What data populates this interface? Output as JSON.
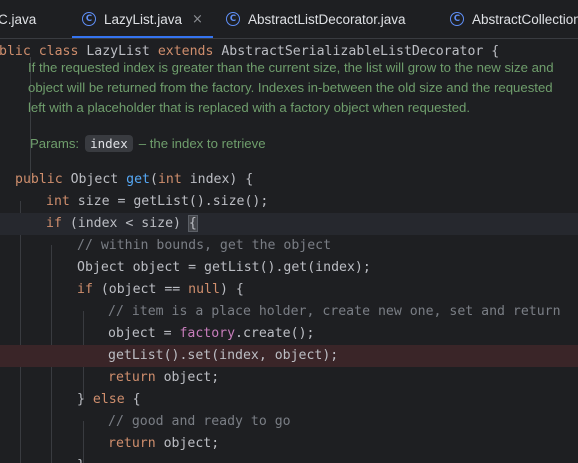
{
  "tabs": [
    {
      "label": "C.java",
      "active": false,
      "icon": "class-icon"
    },
    {
      "label": "LazyList.java",
      "active": true,
      "icon": "class-icon"
    },
    {
      "label": "AbstractListDecorator.java",
      "active": false,
      "icon": "class-icon"
    },
    {
      "label": "AbstractCollection",
      "active": false,
      "icon": "class-icon"
    }
  ],
  "tab_close_glyph": "×",
  "class_icon_glyph": "C",
  "class_decl": {
    "kw1": "blic ",
    "kw2": "class ",
    "name": "LazyList ",
    "kw3": "extends ",
    "super": "AbstractSerializableListDecorator {"
  },
  "javadoc": {
    "lines": [
      "If the requested index is greater than the current size, the list will grow to the new size and",
      "object will be returned from the factory. Indexes in-between the old size and the requested",
      "left with a placeholder that is replaced with a factory object when requested."
    ],
    "params_label": "Params:",
    "param_name": "index",
    "param_desc": "– the index to retrieve"
  },
  "code": {
    "l1": {
      "kw": "public ",
      "type": "Object ",
      "fn": "get",
      "p1": "(",
      "kw2": "int ",
      "rest": "index) {"
    },
    "l2": {
      "kw": "int ",
      "rest": "size = getList().size();"
    },
    "l3": {
      "kw": "if ",
      "rest": "(index < size) ",
      "brace": "{"
    },
    "l4": {
      "comment": "// within bounds, get the object"
    },
    "l5": {
      "rest": "Object object = getList().get(index);"
    },
    "l6": {
      "kw": "if ",
      "p1": "(object == ",
      "kw2": "null",
      "rest": ") {"
    },
    "l7": {
      "comment": "// item is a place holder, create new one, set and return"
    },
    "l8": {
      "a": "object = ",
      "field": "factory",
      "b": ".create();"
    },
    "l9": {
      "rest": "getList().set(index, object);"
    },
    "l10": {
      "kw": "return ",
      "rest": "object;"
    },
    "l11": {
      "a": "} ",
      "kw": "else ",
      "b": "{"
    },
    "l12": {
      "comment": "// good and ready to go"
    },
    "l13": {
      "kw": "return ",
      "rest": "object;"
    },
    "l14": {
      "rest": "}"
    }
  },
  "colors": {
    "background": "#1e1f22",
    "keyword": "#cf8e6d",
    "function": "#56a8f5",
    "comment": "#7a7e85",
    "field": "#c77dbb",
    "doc_text": "#6f9e6c",
    "breakpoint_line": "#3a2528",
    "active_tab_underline": "#3574f0"
  }
}
